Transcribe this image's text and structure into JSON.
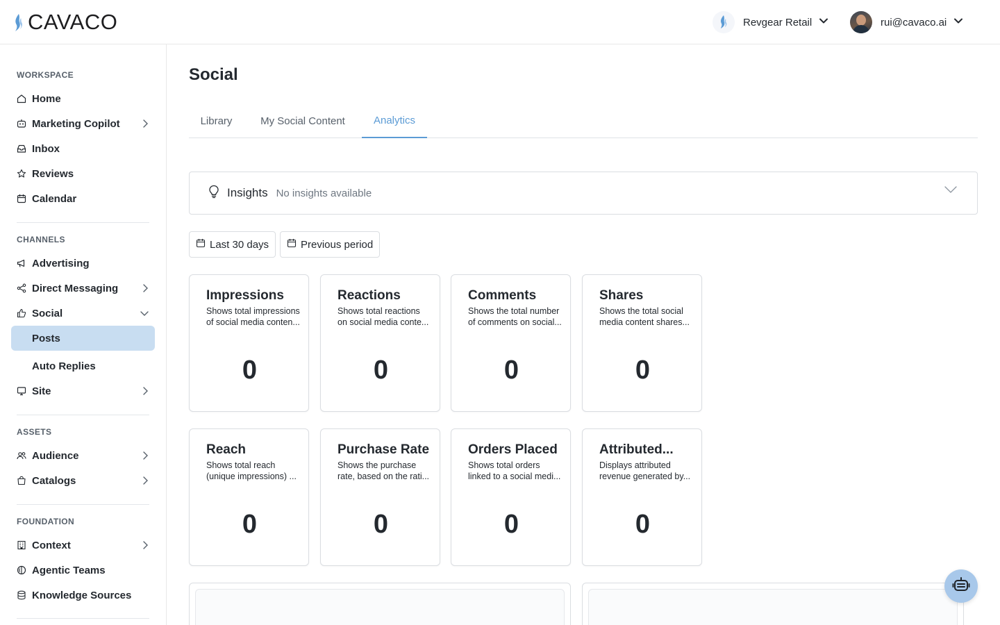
{
  "app": {
    "brand": "CAVACO",
    "brand_icon": "flame-icon",
    "accent_color": "#5b9bd5",
    "active_nav_bg": "#c8ddf1"
  },
  "header": {
    "org_name": "Revgear Retail",
    "user_email": "rui@cavaco.ai"
  },
  "sidebar": {
    "workspace_label": "WORKSPACE",
    "workspace": [
      {
        "label": "Home",
        "icon": "home-icon"
      },
      {
        "label": "Marketing Copilot",
        "icon": "robot-icon",
        "has_children": true
      },
      {
        "label": "Inbox",
        "icon": "inbox-icon"
      },
      {
        "label": "Reviews",
        "icon": "star-icon"
      },
      {
        "label": "Calendar",
        "icon": "calendar-icon"
      }
    ],
    "channels_label": "CHANNELS",
    "channels": [
      {
        "label": "Advertising",
        "icon": "megaphone-icon"
      },
      {
        "label": "Direct Messaging",
        "icon": "share-icon",
        "has_children": true
      },
      {
        "label": "Social",
        "icon": "thumbs-up-icon",
        "expanded": true
      }
    ],
    "social_children": [
      {
        "label": "Posts",
        "active": true
      },
      {
        "label": "Auto Replies"
      }
    ],
    "site": {
      "label": "Site",
      "icon": "monitor-icon",
      "has_children": true
    },
    "assets_label": "ASSETS",
    "assets": [
      {
        "label": "Audience",
        "icon": "users-icon",
        "has_children": true
      },
      {
        "label": "Catalogs",
        "icon": "shopping-bag-icon",
        "has_children": true
      }
    ],
    "foundation_label": "FOUNDATION",
    "foundation": [
      {
        "label": "Context",
        "icon": "building-icon",
        "has_children": true
      },
      {
        "label": "Agentic Teams",
        "icon": "brain-icon"
      },
      {
        "label": "Knowledge Sources",
        "icon": "database-icon"
      }
    ]
  },
  "main": {
    "title": "Social",
    "tabs": [
      {
        "label": "Library"
      },
      {
        "label": "My Social Content"
      },
      {
        "label": "Analytics",
        "active": true
      }
    ],
    "insights": {
      "title": "Insights",
      "status": "No insights available"
    },
    "filters": {
      "range": "Last 30 days",
      "compare": "Previous period"
    },
    "metrics": [
      {
        "title": "Impressions",
        "desc_line1": "Shows total impressions",
        "desc_line2": "of social media conten...",
        "value": "0"
      },
      {
        "title": "Reactions",
        "desc_line1": "Shows total reactions",
        "desc_line2": "on social media conte...",
        "value": "0"
      },
      {
        "title": "Comments",
        "desc_line1": "Shows the total number",
        "desc_line2": "of comments on social...",
        "value": "0"
      },
      {
        "title": "Shares",
        "desc_line1": "Shows the total social",
        "desc_line2": "media content shares...",
        "value": "0"
      },
      {
        "title": "Reach",
        "desc_line1": "Shows total reach",
        "desc_line2": "(unique impressions) ...",
        "value": "0"
      },
      {
        "title": "Purchase Rate",
        "desc_line1": "Shows the purchase",
        "desc_line2": "rate, based on the rati...",
        "value": "0"
      },
      {
        "title": "Orders Placed",
        "desc_line1": "Shows total orders",
        "desc_line2": "linked to a social medi...",
        "value": "0"
      },
      {
        "title": "Attributed...",
        "desc_line1": "Displays attributed",
        "desc_line2": "revenue generated by...",
        "value": "0"
      }
    ]
  }
}
